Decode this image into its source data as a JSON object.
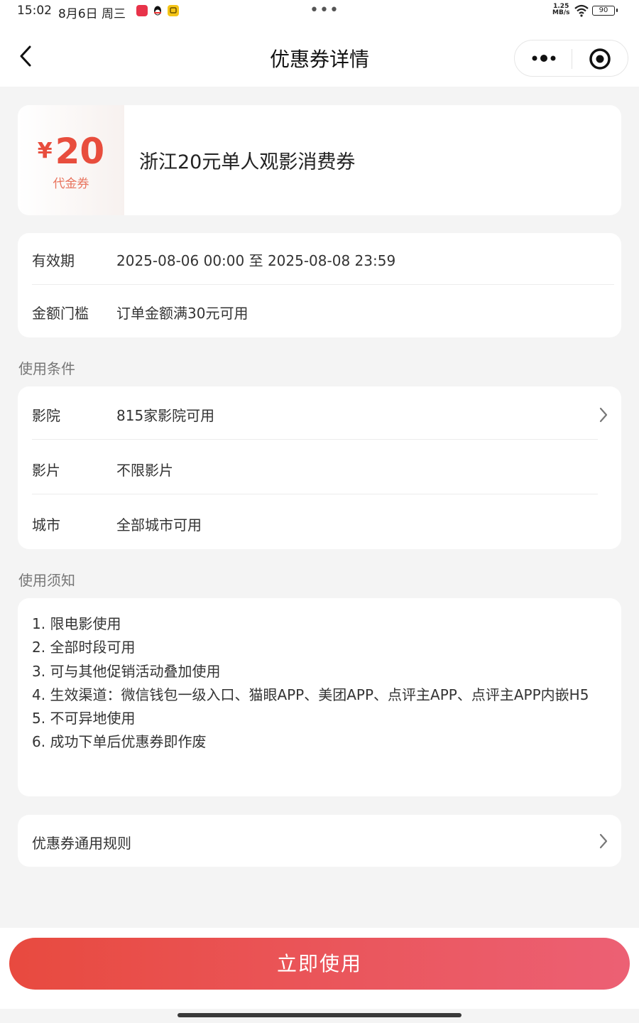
{
  "status_bar": {
    "time": "15:02",
    "date": "8月6日 周三",
    "network_speed": "1.25\nMB/s",
    "battery": "90"
  },
  "nav": {
    "title": "优惠券详情"
  },
  "coupon": {
    "currency_symbol": "¥",
    "amount": "20",
    "type": "代金券",
    "name": "浙江20元单人观影消费券",
    "accent_color": "#e84d3d"
  },
  "info": {
    "rows": [
      {
        "label": "有效期",
        "value": "2025-08-06 00:00 至 2025-08-08 23:59"
      },
      {
        "label": "金额门槛",
        "value": "订单金额满30元可用"
      }
    ]
  },
  "conditions": {
    "title": "使用条件",
    "rows": [
      {
        "label": "影院",
        "value": "815家影院可用"
      },
      {
        "label": "影片",
        "value": "不限影片"
      },
      {
        "label": "城市",
        "value": "全部城市可用"
      }
    ]
  },
  "notes": {
    "title": "使用须知",
    "items": [
      "1.  限电影使用",
      "2. 全部时段可用",
      "3. 可与其他促销活动叠加使用",
      "4. 生效渠道：微信钱包一级入口、猫眼APP、美团APP、点评主APP、点评主APP内嵌H5",
      "5. 不可异地使用",
      "6. 成功下单后优惠券即作废"
    ]
  },
  "rules": {
    "label": "优惠券通用规则"
  },
  "action": {
    "label": "立即使用",
    "gradient_from": "#e84a3f",
    "gradient_to": "#ec6074"
  }
}
